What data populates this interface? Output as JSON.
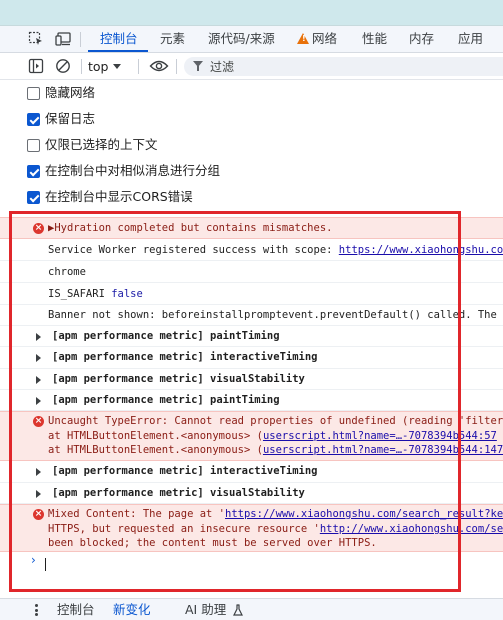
{
  "tabs": [
    {
      "label": "控制台",
      "active": true
    },
    {
      "label": "元素"
    },
    {
      "label": "源代码/来源"
    },
    {
      "label": "网络",
      "icon": "warning-triangle-icon"
    },
    {
      "label": "性能"
    },
    {
      "label": "内存"
    },
    {
      "label": "应用"
    }
  ],
  "toolbar": {
    "context": "top",
    "filter_placeholder": "过滤"
  },
  "settings": [
    {
      "label": "隐藏网络",
      "checked": false
    },
    {
      "label": "保留日志",
      "checked": true
    },
    {
      "label": "仅限已选择的上下文",
      "checked": false
    },
    {
      "label": "在控制台中对相似消息进行分组",
      "checked": true
    },
    {
      "label": "在控制台中显示CORS错误",
      "checked": true
    }
  ],
  "console": {
    "messages": [
      {
        "type": "error",
        "text": "▶Hydration completed but contains mismatches."
      },
      {
        "type": "log",
        "text": "Service Worker registered success with scope: ",
        "link": "https://www.xiaohongshu.com/"
      },
      {
        "type": "log",
        "text": "chrome"
      },
      {
        "type": "log",
        "text": "IS_SAFARI ",
        "value": "false"
      },
      {
        "type": "log",
        "text": "Banner not shown: beforeinstallpromptevent.preventDefault() called. The page"
      },
      {
        "type": "group",
        "text": "[apm performance metric] paintTiming"
      },
      {
        "type": "group",
        "text": "[apm performance metric] interactiveTiming"
      },
      {
        "type": "group",
        "text": "[apm performance metric] visualStability"
      },
      {
        "type": "group",
        "text": "[apm performance metric] paintTiming"
      },
      {
        "type": "error",
        "text": "Uncaught TypeError: Cannot read properties of undefined (reading 'filter')",
        "stack": [
          {
            "prefix": "    at HTMLButtonElement.<anonymous> (",
            "link": "userscript.html?name=…-7078394b544:57"
          },
          {
            "prefix": "    at HTMLButtonElement.<anonymous> (",
            "link": "userscript.html?name=…-7078394b544:147"
          }
        ]
      },
      {
        "type": "group",
        "text": "[apm performance metric] interactiveTiming"
      },
      {
        "type": "group",
        "text": "[apm performance metric] visualStability"
      },
      {
        "type": "error",
        "text": "Mixed Content: The page at '",
        "link1": "https://www.xiaohongshu.com/search_result?keyword",
        "line2_prefix": "HTTPS, but requested an insecure resource '",
        "link2": "http://www.xiaohongshu.com/search",
        "line3": "been blocked; the content must be served over HTTPS."
      }
    ],
    "prompt": "›"
  },
  "drawer": {
    "tabs": [
      {
        "label": "控制台"
      },
      {
        "label": "新变化",
        "active": true
      },
      {
        "label": "AI 助理"
      }
    ]
  },
  "colors": {
    "accent": "#0b57d0",
    "error_bg": "#fce8e6",
    "error_text": "#8a1c14",
    "highlight_box": "#e0262b"
  }
}
